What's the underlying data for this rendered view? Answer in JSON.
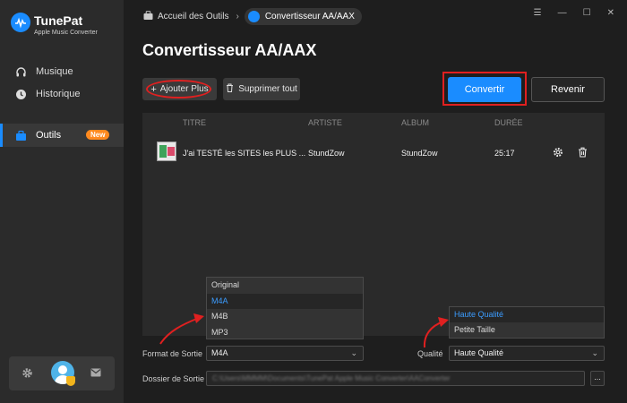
{
  "app": {
    "name": "TunePat",
    "subtitle": "Apple Music Converter"
  },
  "sidebar": {
    "items": [
      {
        "label": "Musique",
        "icon": "headphones-icon"
      },
      {
        "label": "Historique",
        "icon": "clock-icon"
      },
      {
        "label": "Outils",
        "icon": "toolbox-icon",
        "badge": "New",
        "active": true
      }
    ]
  },
  "breadcrumb": {
    "root": "Accueil des Outils",
    "current": "Convertisseur AA/AAX"
  },
  "page_title": "Convertisseur AA/AAX",
  "toolbar": {
    "add_label": "Ajouter Plus",
    "delete_label": "Supprimer tout",
    "convert_label": "Convertir",
    "back_label": "Revenir"
  },
  "table": {
    "headers": {
      "title": "TITRE",
      "artist": "ARTISTE",
      "album": "ALBUM",
      "duration": "DURÉE"
    },
    "rows": [
      {
        "title": "J'ai TESTÉ les SITES les PLUS ...",
        "artist": "StundZow",
        "album": "StundZow",
        "duration": "25:17"
      }
    ]
  },
  "format_dropdown": {
    "options": [
      "Original",
      "M4A",
      "M4B",
      "MP3"
    ],
    "selected": "M4A"
  },
  "quality_dropdown": {
    "options": [
      "Haute Qualité",
      "Petite Taille"
    ],
    "selected": "Haute Qualité"
  },
  "settings": {
    "format_label": "Format de Sortie",
    "format_value": "M4A",
    "quality_label": "Qualité",
    "quality_value": "Haute Qualité",
    "folder_label": "Dossier de Sortie",
    "folder_value": "C:\\Users\\MMMM\\Documents\\TunePat Apple Music Converter\\AAConverter",
    "more_label": "..."
  },
  "colors": {
    "accent": "#1a8cff",
    "highlight": "#e02020",
    "badge": "#ff8a1f"
  }
}
